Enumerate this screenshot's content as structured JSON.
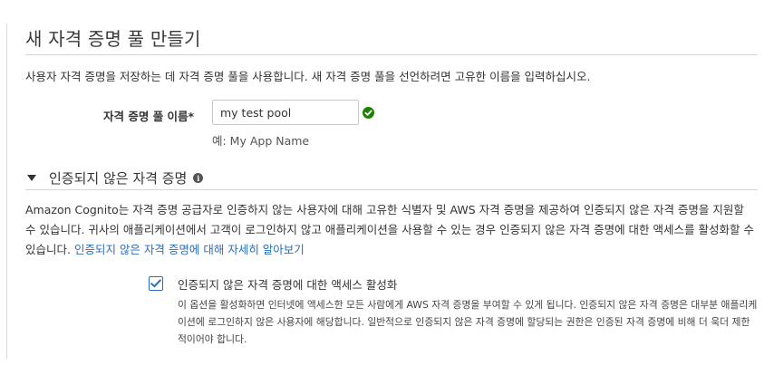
{
  "page": {
    "title": "새 자격 증명 풀 만들기",
    "intro": "사용자 자격 증명을 저장하는 데 자격 증명 풀을 사용합니다. 새 자격 증명 풀을 선언하려면 고유한 이름을 입력하십시오."
  },
  "pool_name": {
    "label": "자격 증명 풀 이름*",
    "value": "my test pool",
    "example": "예: My App Name",
    "status_icon": "valid-check-icon",
    "status_color": "#1d8102"
  },
  "unauth_section": {
    "title": "인증되지 않은 자격 증명",
    "expanded": true,
    "info_icon": "i",
    "description": "Amazon Cognito는 자격 증명 공급자로 인증하지 않는 사용자에 대해 고유한 식별자 및 AWS 자격 증명을 제공하여 인증되지 않은 자격 증명을 지원할 수 있습니다. 귀사의 애플리케이션에서 고객이 로그인하지 않고 애플리케이션을 사용할 수 있는 경우 인증되지 않은 자격 증명에 대한 액세스를 활성화할 수 있습니다. ",
    "learn_more_link": "인증되지 않은 자격 증명에 대해 자세히 알아보기",
    "checkbox_label": "인증되지 않은 자격 증명에 대한 액세스 활성화",
    "checkbox_checked": true,
    "checkbox_help": "이 옵션을 활성화하면 인터넷에 액세스한 모든 사람에게 AWS 자격 증명을 부여할 수 있게 됩니다. 인증되지 않은 자격 증명은 대부분 애플리케이션에 로그인하지 않은 사용자에 해당합니다. 일반적으로 인증되지 않은 자격 증명에 할당되는 권한은 인증된 자격 증명에 비해 더 욱더 제한적이어야 합니다."
  },
  "colors": {
    "link": "#2a6ebb",
    "checkbox": "#2a6ebb",
    "valid": "#1d8102"
  }
}
